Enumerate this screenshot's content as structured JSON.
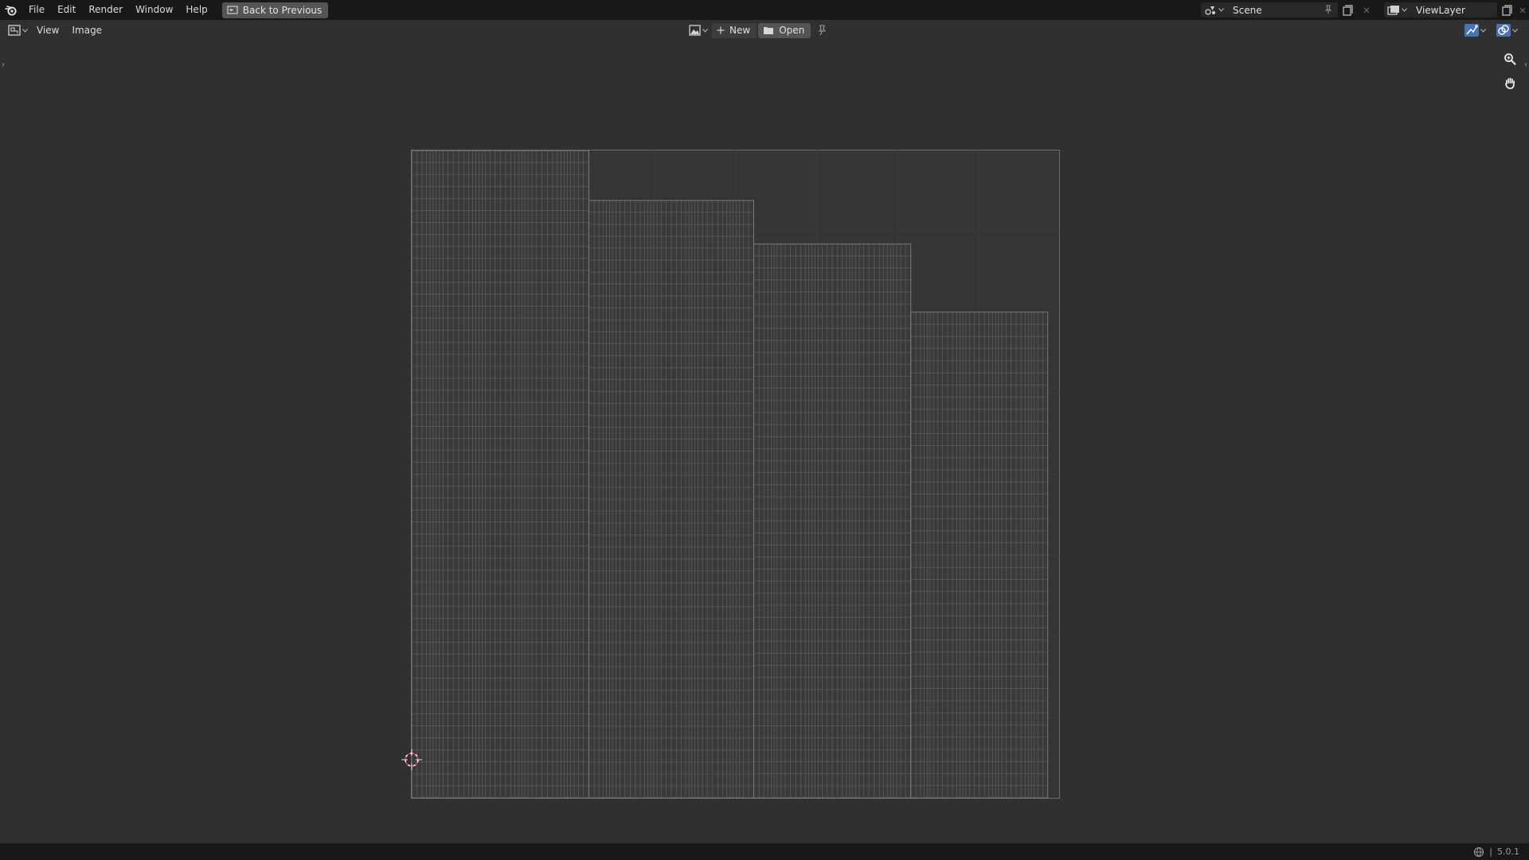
{
  "menu": {
    "items": [
      "File",
      "Edit",
      "Render",
      "Window",
      "Help"
    ],
    "back_button": "Back to Previous"
  },
  "topbar_right": {
    "scene": "Scene",
    "view_layer": "ViewLayer"
  },
  "editor_header": {
    "menus": [
      "View",
      "Image"
    ],
    "new_label": "New",
    "open_label": "Open"
  },
  "uv_editor": {
    "columns": [
      {
        "top": 1.0,
        "width": 0.273,
        "vlines": 42,
        "hlines": 54
      },
      {
        "top": 0.923,
        "width": 0.254,
        "vlines": 40,
        "hlines": 50
      },
      {
        "top": 0.856,
        "width": 0.242,
        "vlines": 38,
        "hlines": 46
      },
      {
        "top": 0.751,
        "width": 0.211,
        "vlines": 34,
        "hlines": 40
      }
    ]
  },
  "colors": {
    "accent_blue": "#4772b3",
    "cursor_red": "#d23c3c",
    "grid_line": "#7a7a7a"
  },
  "status": {
    "version": "5.0.1"
  }
}
